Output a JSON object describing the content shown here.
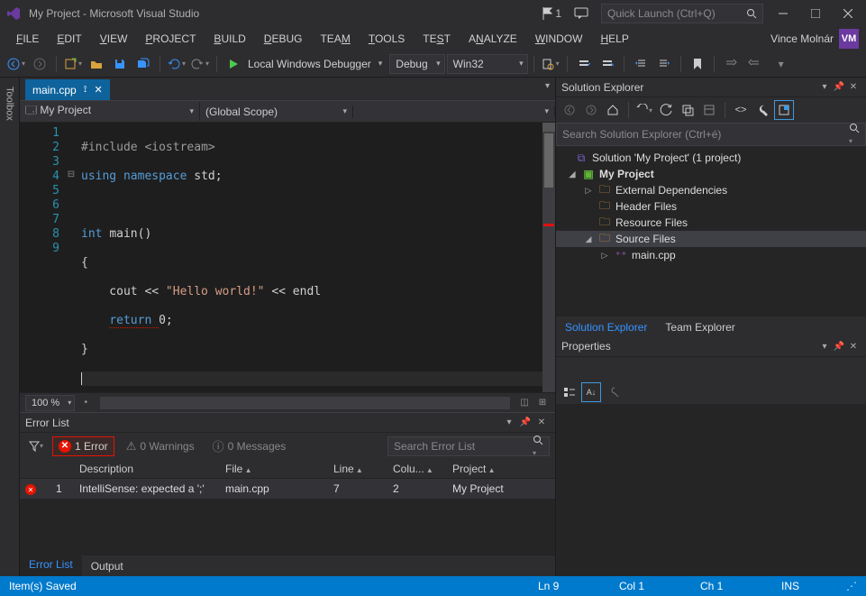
{
  "titlebar": {
    "title": "My Project - Microsoft Visual Studio",
    "notif_count": "1",
    "quicklaunch_placeholder": "Quick Launch (Ctrl+Q)"
  },
  "menubar": {
    "items": [
      "FILE",
      "EDIT",
      "VIEW",
      "PROJECT",
      "BUILD",
      "DEBUG",
      "TEAM",
      "TOOLS",
      "TEST",
      "ANALYZE",
      "WINDOW",
      "HELP"
    ],
    "user": "Vince Molnár",
    "user_initials": "VM"
  },
  "toolbar": {
    "debugger_label": "Local Windows Debugger",
    "config": "Debug",
    "platform": "Win32"
  },
  "lefttool": {
    "toolbox": "Toolbox"
  },
  "doctab": {
    "filename": "main.cpp"
  },
  "navrow": {
    "scope1": "My Project",
    "scope2": "(Global Scope)",
    "scope3": ""
  },
  "code": {
    "l1a": "#include ",
    "l1b": "<iostream>",
    "l2a": "using ",
    "l2b": "namespace ",
    "l2c": "std;",
    "l4a": "int ",
    "l4b": "main()",
    "l5": "{",
    "l6a": "    cout << ",
    "l6b": "\"Hello world!\"",
    "l6c": " << endl",
    "l7a": "    ",
    "l7b": "return ",
    "l7c": "0;",
    "l8": "}",
    "line_numbers": [
      "1",
      "2",
      "3",
      "4",
      "5",
      "6",
      "7",
      "8",
      "9"
    ]
  },
  "zoom": {
    "value": "100 %"
  },
  "errorlist": {
    "title": "Error List",
    "errors_label": "1 Error",
    "warnings_label": "0 Warnings",
    "messages_label": "0 Messages",
    "search_placeholder": "Search Error List",
    "cols": {
      "desc": "Description",
      "file": "File",
      "line": "Line",
      "col": "Colu...",
      "proj": "Project"
    },
    "rows": [
      {
        "num": "1",
        "desc": "IntelliSense: expected a ';'",
        "file": "main.cpp",
        "line": "7",
        "col": "2",
        "proj": "My Project"
      }
    ],
    "tabs": {
      "errorlist": "Error List",
      "output": "Output"
    }
  },
  "solution": {
    "title": "Solution Explorer",
    "search_placeholder": "Search Solution Explorer (Ctrl+é)",
    "sol": "Solution 'My Project' (1 project)",
    "proj": "My Project",
    "extdeps": "External Dependencies",
    "hdr": "Header Files",
    "res": "Resource Files",
    "src": "Source Files",
    "main": "main.cpp",
    "tabs": {
      "se": "Solution Explorer",
      "te": "Team Explorer"
    }
  },
  "properties": {
    "title": "Properties"
  },
  "status": {
    "msg": "Item(s) Saved",
    "ln": "Ln 9",
    "col": "Col 1",
    "ch": "Ch 1",
    "ins": "INS"
  }
}
